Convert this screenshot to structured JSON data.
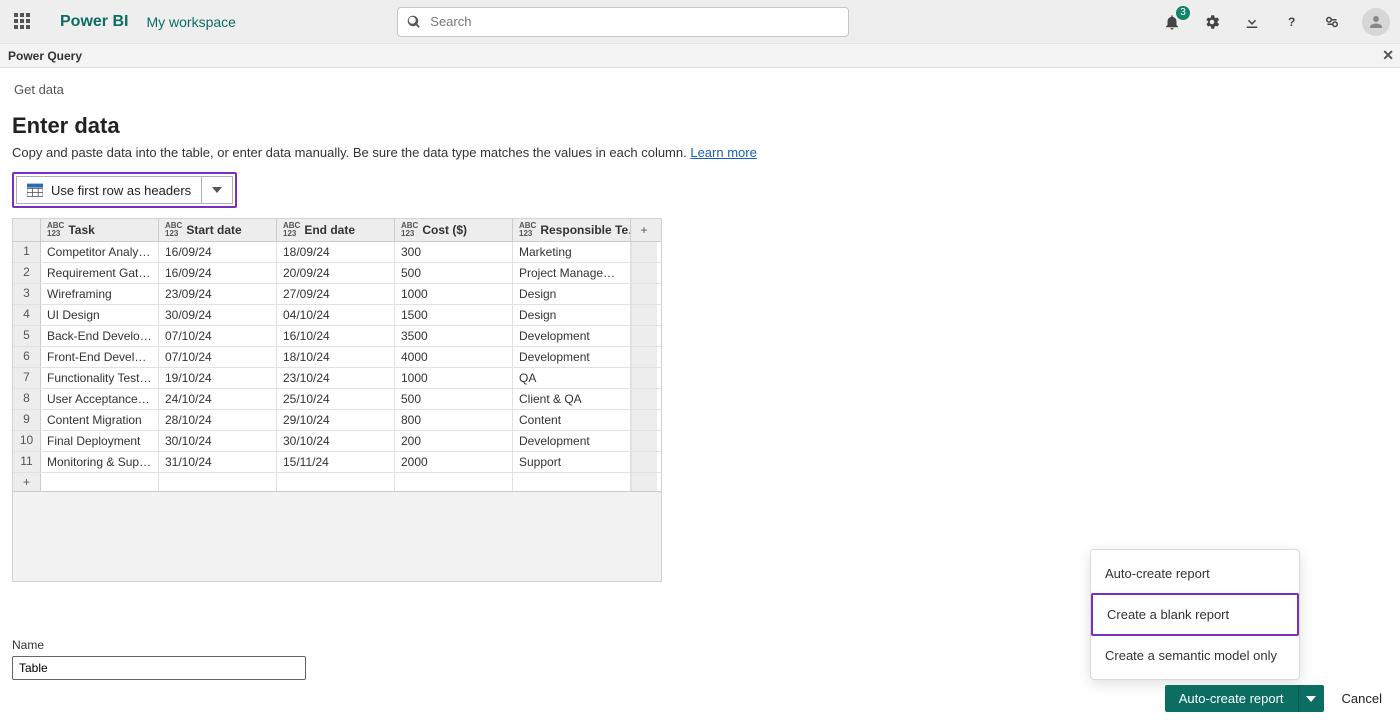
{
  "brand": "Power BI",
  "workspace": "My workspace",
  "search_placeholder": "Search",
  "notif_count": "3",
  "pq_title": "Power Query",
  "breadcrumb": "Get data",
  "page_title": "Enter data",
  "description": "Copy and paste data into the table, or enter data manually. Be sure the data type matches the values in each column. ",
  "learn_more": "Learn more",
  "headers_btn": "Use first row as headers",
  "columns": [
    "Task",
    "Start date",
    "End date",
    "Cost ($)",
    "Responsible Te…"
  ],
  "col_type_top": "ABC",
  "col_type_bot": "123",
  "rows": [
    {
      "n": "1",
      "c": [
        "Competitor Analysis",
        "16/09/24",
        "18/09/24",
        "300",
        "Marketing"
      ]
    },
    {
      "n": "2",
      "c": [
        "Requirement Gathe…",
        "16/09/24",
        "20/09/24",
        "500",
        "Project Management"
      ]
    },
    {
      "n": "3",
      "c": [
        "Wireframing",
        "23/09/24",
        "27/09/24",
        "1000",
        "Design"
      ]
    },
    {
      "n": "4",
      "c": [
        "UI Design",
        "30/09/24",
        "04/10/24",
        "1500",
        "Design"
      ]
    },
    {
      "n": "5",
      "c": [
        "Back-End Develop…",
        "07/10/24",
        "16/10/24",
        "3500",
        "Development"
      ]
    },
    {
      "n": "6",
      "c": [
        "Front-End Develop…",
        "07/10/24",
        "18/10/24",
        "4000",
        "Development"
      ]
    },
    {
      "n": "7",
      "c": [
        "Functionality Testing",
        "19/10/24",
        "23/10/24",
        "1000",
        "QA"
      ]
    },
    {
      "n": "8",
      "c": [
        "User Acceptance T…",
        "24/10/24",
        "25/10/24",
        "500",
        "Client & QA"
      ]
    },
    {
      "n": "9",
      "c": [
        "Content Migration",
        "28/10/24",
        "29/10/24",
        "800",
        "Content"
      ]
    },
    {
      "n": "10",
      "c": [
        "Final Deployment",
        "30/10/24",
        "30/10/24",
        "200",
        "Development"
      ]
    },
    {
      "n": "11",
      "c": [
        "Monitoring & Support",
        "31/10/24",
        "15/11/24",
        "2000",
        "Support"
      ]
    }
  ],
  "add_row": "+",
  "add_col": "+",
  "name_label": "Name",
  "name_value": "Table",
  "menu": {
    "auto": "Auto-create report",
    "blank": "Create a blank report",
    "semantic": "Create a semantic model only"
  },
  "primary_btn": "Auto-create report",
  "cancel_btn": "Cancel"
}
